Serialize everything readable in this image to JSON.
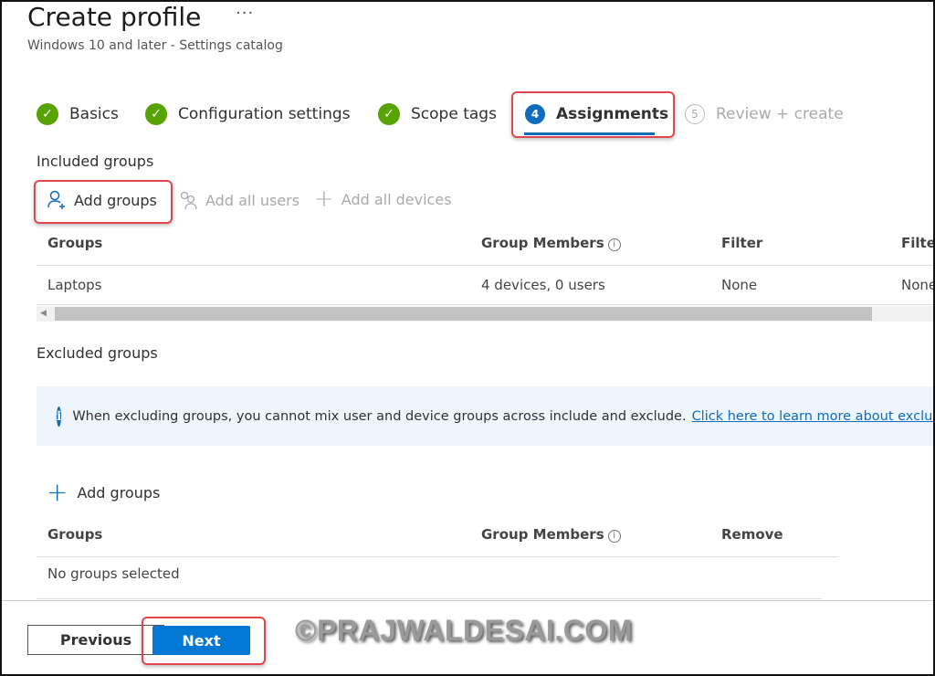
{
  "header": {
    "title": "Create profile",
    "more": "···",
    "subtitle": "Windows 10 and later - Settings catalog"
  },
  "steps": [
    {
      "label": "Basics",
      "state": "complete",
      "icon": "check-icon"
    },
    {
      "label": "Configuration settings",
      "state": "complete",
      "icon": "check-icon"
    },
    {
      "label": "Scope tags",
      "state": "complete",
      "icon": "check-icon"
    },
    {
      "number": "4",
      "label": "Assignments",
      "state": "active"
    },
    {
      "number": "5",
      "label": "Review + create",
      "state": "disabled"
    }
  ],
  "included": {
    "heading": "Included groups",
    "toolbar": {
      "add_groups": "Add groups",
      "add_all_users": "Add all users",
      "add_all_devices": "Add all devices"
    },
    "columns": [
      "Groups",
      "Group Members",
      "Filter",
      "Filter"
    ],
    "rows": [
      [
        "Laptops",
        "4 devices, 0 users",
        "None",
        "None"
      ]
    ]
  },
  "excluded": {
    "heading": "Excluded groups",
    "banner_text": "When excluding groups, you cannot mix user and device groups across include and exclude.",
    "banner_link": "Click here to learn more about excluding",
    "add_groups": "Add groups",
    "columns": [
      "Groups",
      "Group Members",
      "Remove"
    ],
    "empty": "No groups selected"
  },
  "footer": {
    "previous": "Previous",
    "next": "Next"
  },
  "watermark": "©PRAJWALDESAI.COM",
  "colors": {
    "accent": "#0f6cbd",
    "complete": "#57a300",
    "highlight": "#e0474c"
  }
}
